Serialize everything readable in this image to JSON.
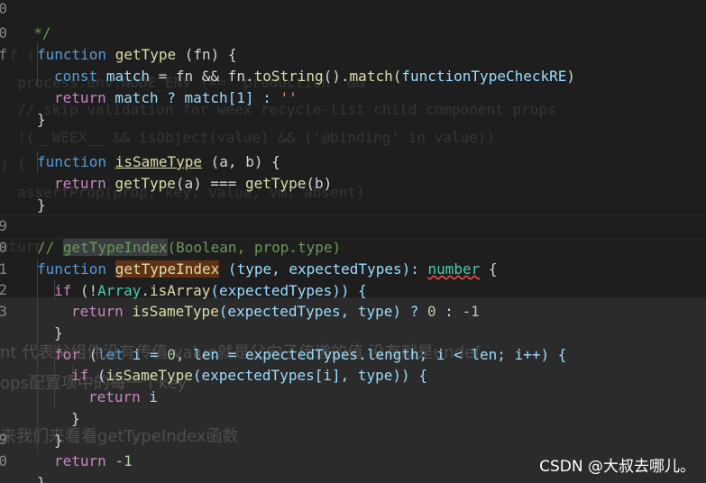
{
  "watermark": "CSDN @大叔去哪儿。",
  "gutter": [
    "0",
    "0",
    "f",
    "",
    "",
    "",
    "",
    "",
    "",
    "9",
    "0",
    "1",
    "2",
    "3",
    "",
    "",
    "",
    "",
    "",
    "9",
    "0"
  ],
  "background_text": {
    "lines": [
      "f (",
      "  process.env.NODE_ENV !== 'production' &&",
      "  // skip validation for weex recycle-list child component props",
      "  !(__WEEX__ && isObject(value) && ('@binding' in value))",
      ") {",
      "  assertProp(prop, key, value, vm, absent)",
      "eturn"
    ],
    "chinese_lines": [
      "nt 代表父组件没有传值 value就是父向子传递的值 没有就是undef",
      "ops配置项中的每一个key",
      "来我们来看看getTypeIndex函数"
    ]
  },
  "code": {
    "l0": "  */",
    "l1_kw": "function",
    "l1_fn": "getType",
    "l1_rest": " (fn) {",
    "l2_kw": "const",
    "l2_var": "match",
    "l2_a": " = fn && fn.",
    "l2_fn1": "toString",
    "l2_b": "().",
    "l2_fn2": "match",
    "l2_c": "(",
    "l2_var2": "functionTypeCheckRE",
    "l2_d": ")",
    "l3_kw": "return",
    "l3_a": " match ? match[1] : ",
    "l3_str": "''",
    "l4": "}",
    "l5_kw": "function",
    "l5_fn": "isSameType",
    "l5_rest": " (a, b) {",
    "l6_kw": "return",
    "l6_fn1": "getType",
    "l6_a": "(a) === ",
    "l6_fn2": "getType",
    "l6_b": "(b)",
    "l7": "}",
    "l9_cmt1": "// ",
    "l9_cmt_hl": "getTypeIndex",
    "l9_cmt2": "(Boolean, prop.type)",
    "l10_kw": "function",
    "l10_fn": "getTypeIndex",
    "l10_a": " (type, expectedTypes): ",
    "l10_type": "number",
    "l10_b": " {",
    "l11_kw": "if",
    "l11_a": " (!",
    "l11_cls": "Array",
    "l11_b": ".",
    "l11_fn": "isArray",
    "l11_c": "(expectedTypes)) {",
    "l12_kw": "return",
    "l12_fn": "isSameType",
    "l12_a": "(expectedTypes, type) ? ",
    "l12_n0": "0",
    "l12_b": " : ",
    "l12_n1": "-1",
    "l13": "}",
    "l14_kw": "for",
    "l14_a": " (",
    "l14_kw2": "let",
    "l14_b": " i = ",
    "l14_n": "0",
    "l14_c": ", len = expectedTypes.length; i < len; i++) {",
    "l15_kw": "if",
    "l15_a": " (",
    "l15_fn": "isSameType",
    "l15_b": "(expectedTypes[i], type)) {",
    "l16_kw": "return",
    "l16_a": " i",
    "l17": "}",
    "l18": "}",
    "l19_kw": "return",
    "l19_n": "-1",
    "l20": "}"
  }
}
